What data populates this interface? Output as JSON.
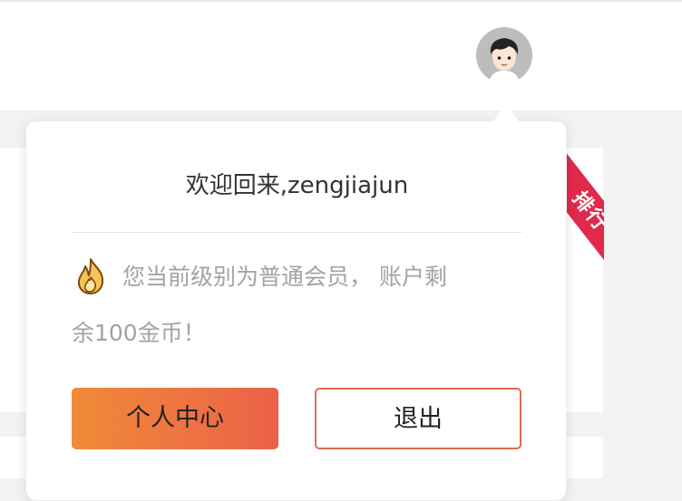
{
  "header": {
    "avatar_icon": "user-avatar-icon"
  },
  "ribbon": {
    "label": "排行",
    "color": "#e0294b"
  },
  "popover": {
    "welcome": "欢迎回来,zengjiajun",
    "level_icon": "fire-icon",
    "level_line1": "您当前级别为普通会员， 账户剩",
    "level_line2": "余100金币！",
    "primary_button": "个人中心",
    "logout_button": "退出",
    "accent_gradient": [
      "#f08a38",
      "#ec6149"
    ],
    "logout_border": "#e26b52"
  }
}
